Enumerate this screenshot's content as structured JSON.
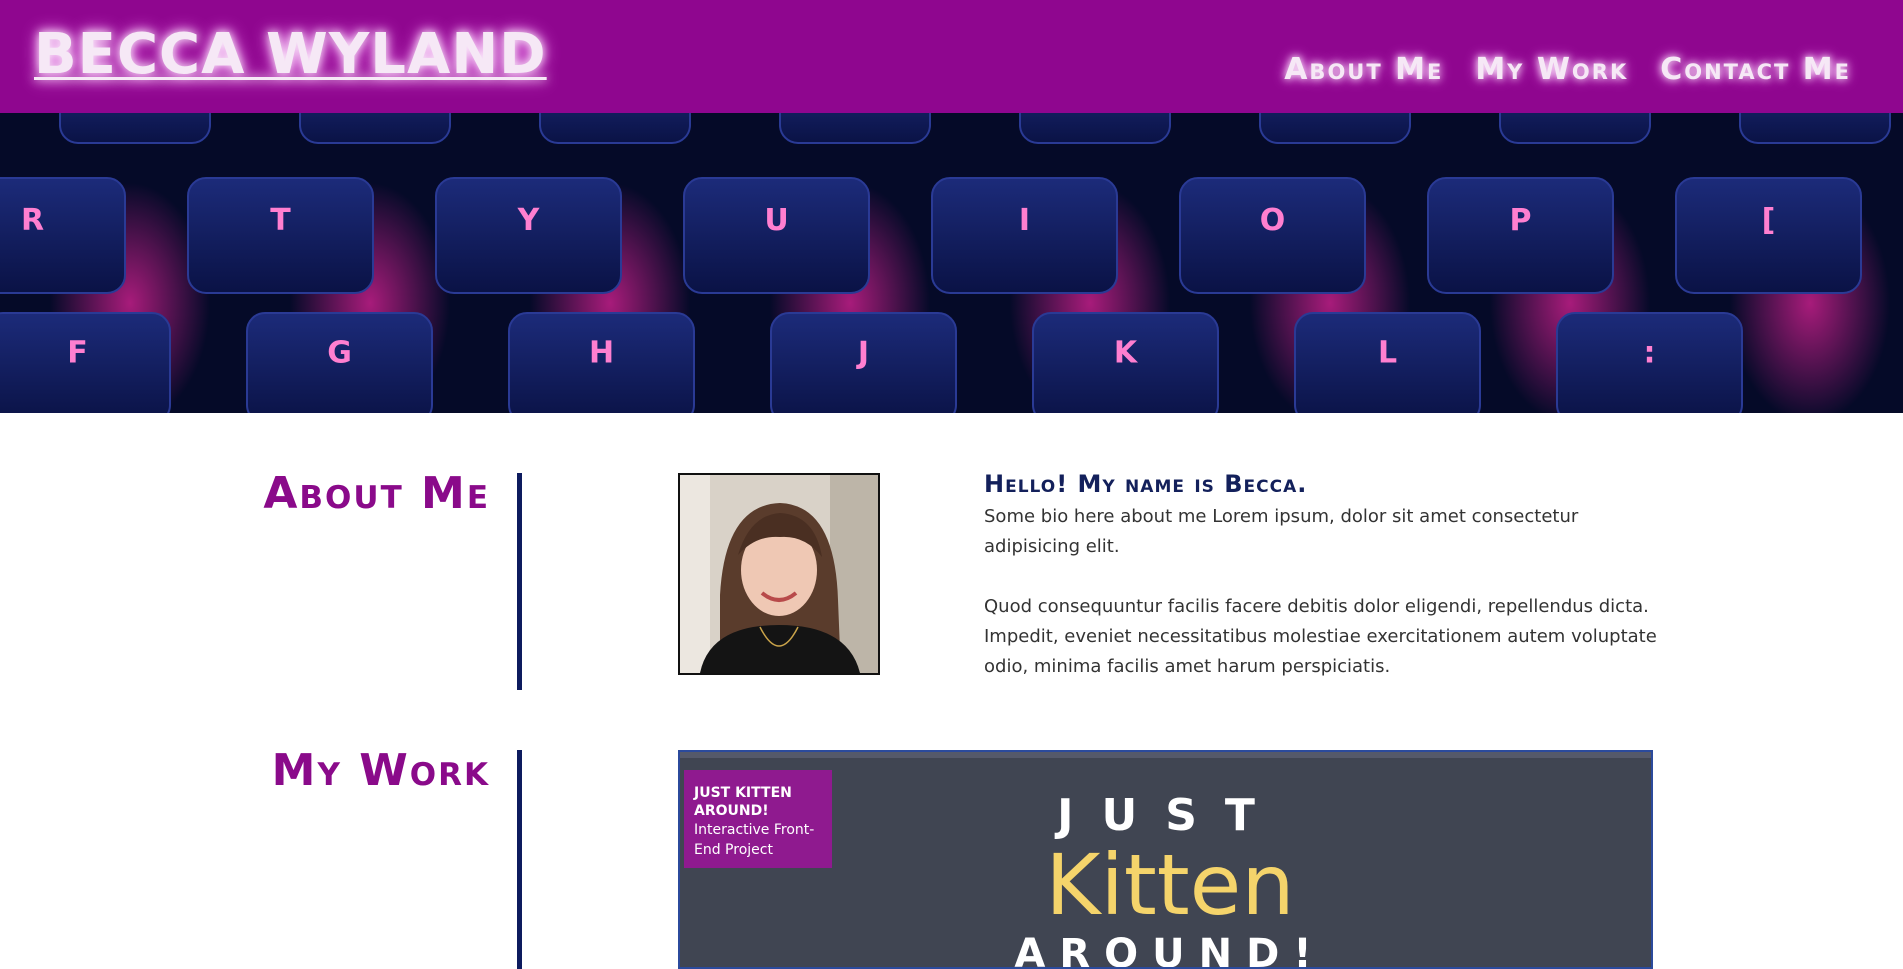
{
  "header": {
    "brand": "BECCA WYLAND",
    "nav": [
      {
        "label": "About Me"
      },
      {
        "label": "My Work"
      },
      {
        "label": "Contact Me"
      }
    ]
  },
  "hero": {
    "keys_row1": [
      "R",
      "T",
      "Y",
      "U",
      "I",
      "O",
      "P",
      "["
    ],
    "keys_row2": [
      "F",
      "G",
      "H",
      "J",
      "K",
      "L",
      ":"
    ]
  },
  "about": {
    "title": "About Me",
    "greeting": "Hello! My name is Becca.",
    "paragraphs": [
      "Some bio here about me  Lorem ipsum, dolor sit amet consectetur adipisicing elit.",
      "Quod consequuntur facilis facere debitis dolor eligendi, repellendus dicta. Impedit, eveniet necessitatibus molestiae exercitationem autem voluptate odio, minima facilis amet harum perspiciatis."
    ]
  },
  "work": {
    "title": "My Work",
    "projects": [
      {
        "tag_title": "Just Kitten Around!",
        "tag_subtitle": "Interactive Front-End Project",
        "logo_top": "JUST",
        "logo_mid": "Kitten",
        "logo_bottom": "AROUND!"
      }
    ]
  },
  "colors": {
    "header_bg": "#8f068f",
    "accent_purple": "#8a0a8a",
    "navy": "#13205b",
    "card_bg": "#404552",
    "logo_yellow": "#f5d46b"
  }
}
